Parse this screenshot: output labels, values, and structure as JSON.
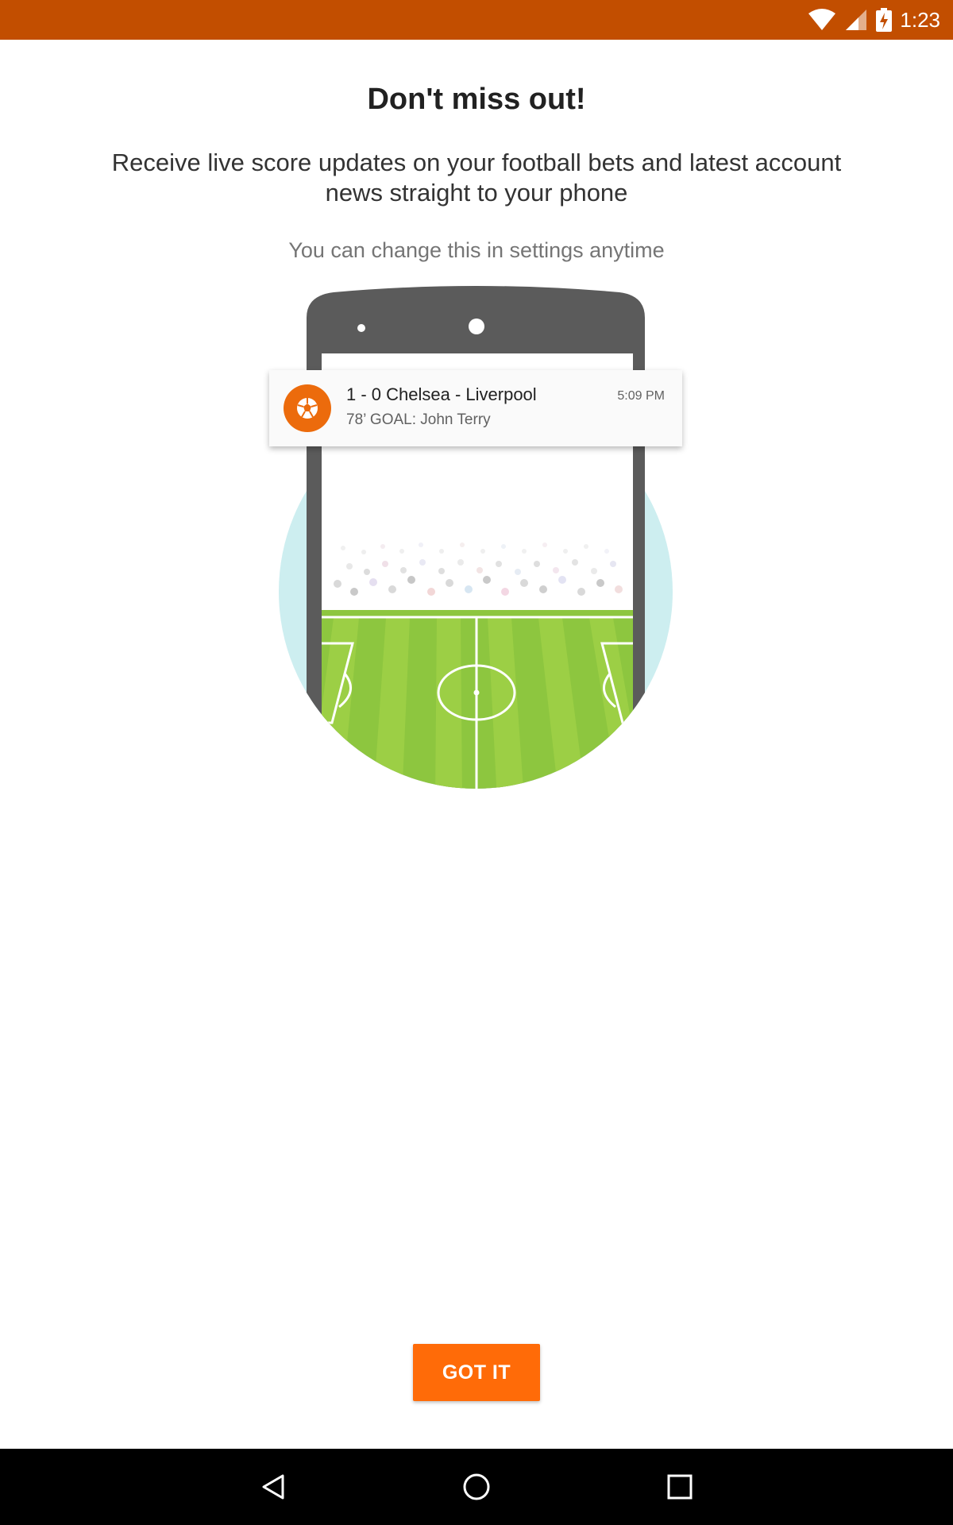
{
  "status_bar": {
    "time": "1:23",
    "icons": [
      "wifi-icon",
      "cell-signal-icon",
      "battery-charging-icon"
    ],
    "background": "#c24e00"
  },
  "onboarding": {
    "title": "Don't miss out!",
    "description": "Receive live score updates on your football bets and latest account news straight to your phone",
    "hint": "You can change this in settings anytime"
  },
  "notification": {
    "icon": "football-icon",
    "title": "1 - 0 Chelsea - Liverpool",
    "subtitle": "78’ GOAL: John Terry",
    "time": "5:09 PM",
    "accent": "#ec6b0c"
  },
  "actions": {
    "got_it": "GOT IT",
    "accent": "#ff6b08"
  },
  "navigation_bar": {
    "buttons": [
      "back-icon",
      "home-icon",
      "recents-icon"
    ]
  }
}
